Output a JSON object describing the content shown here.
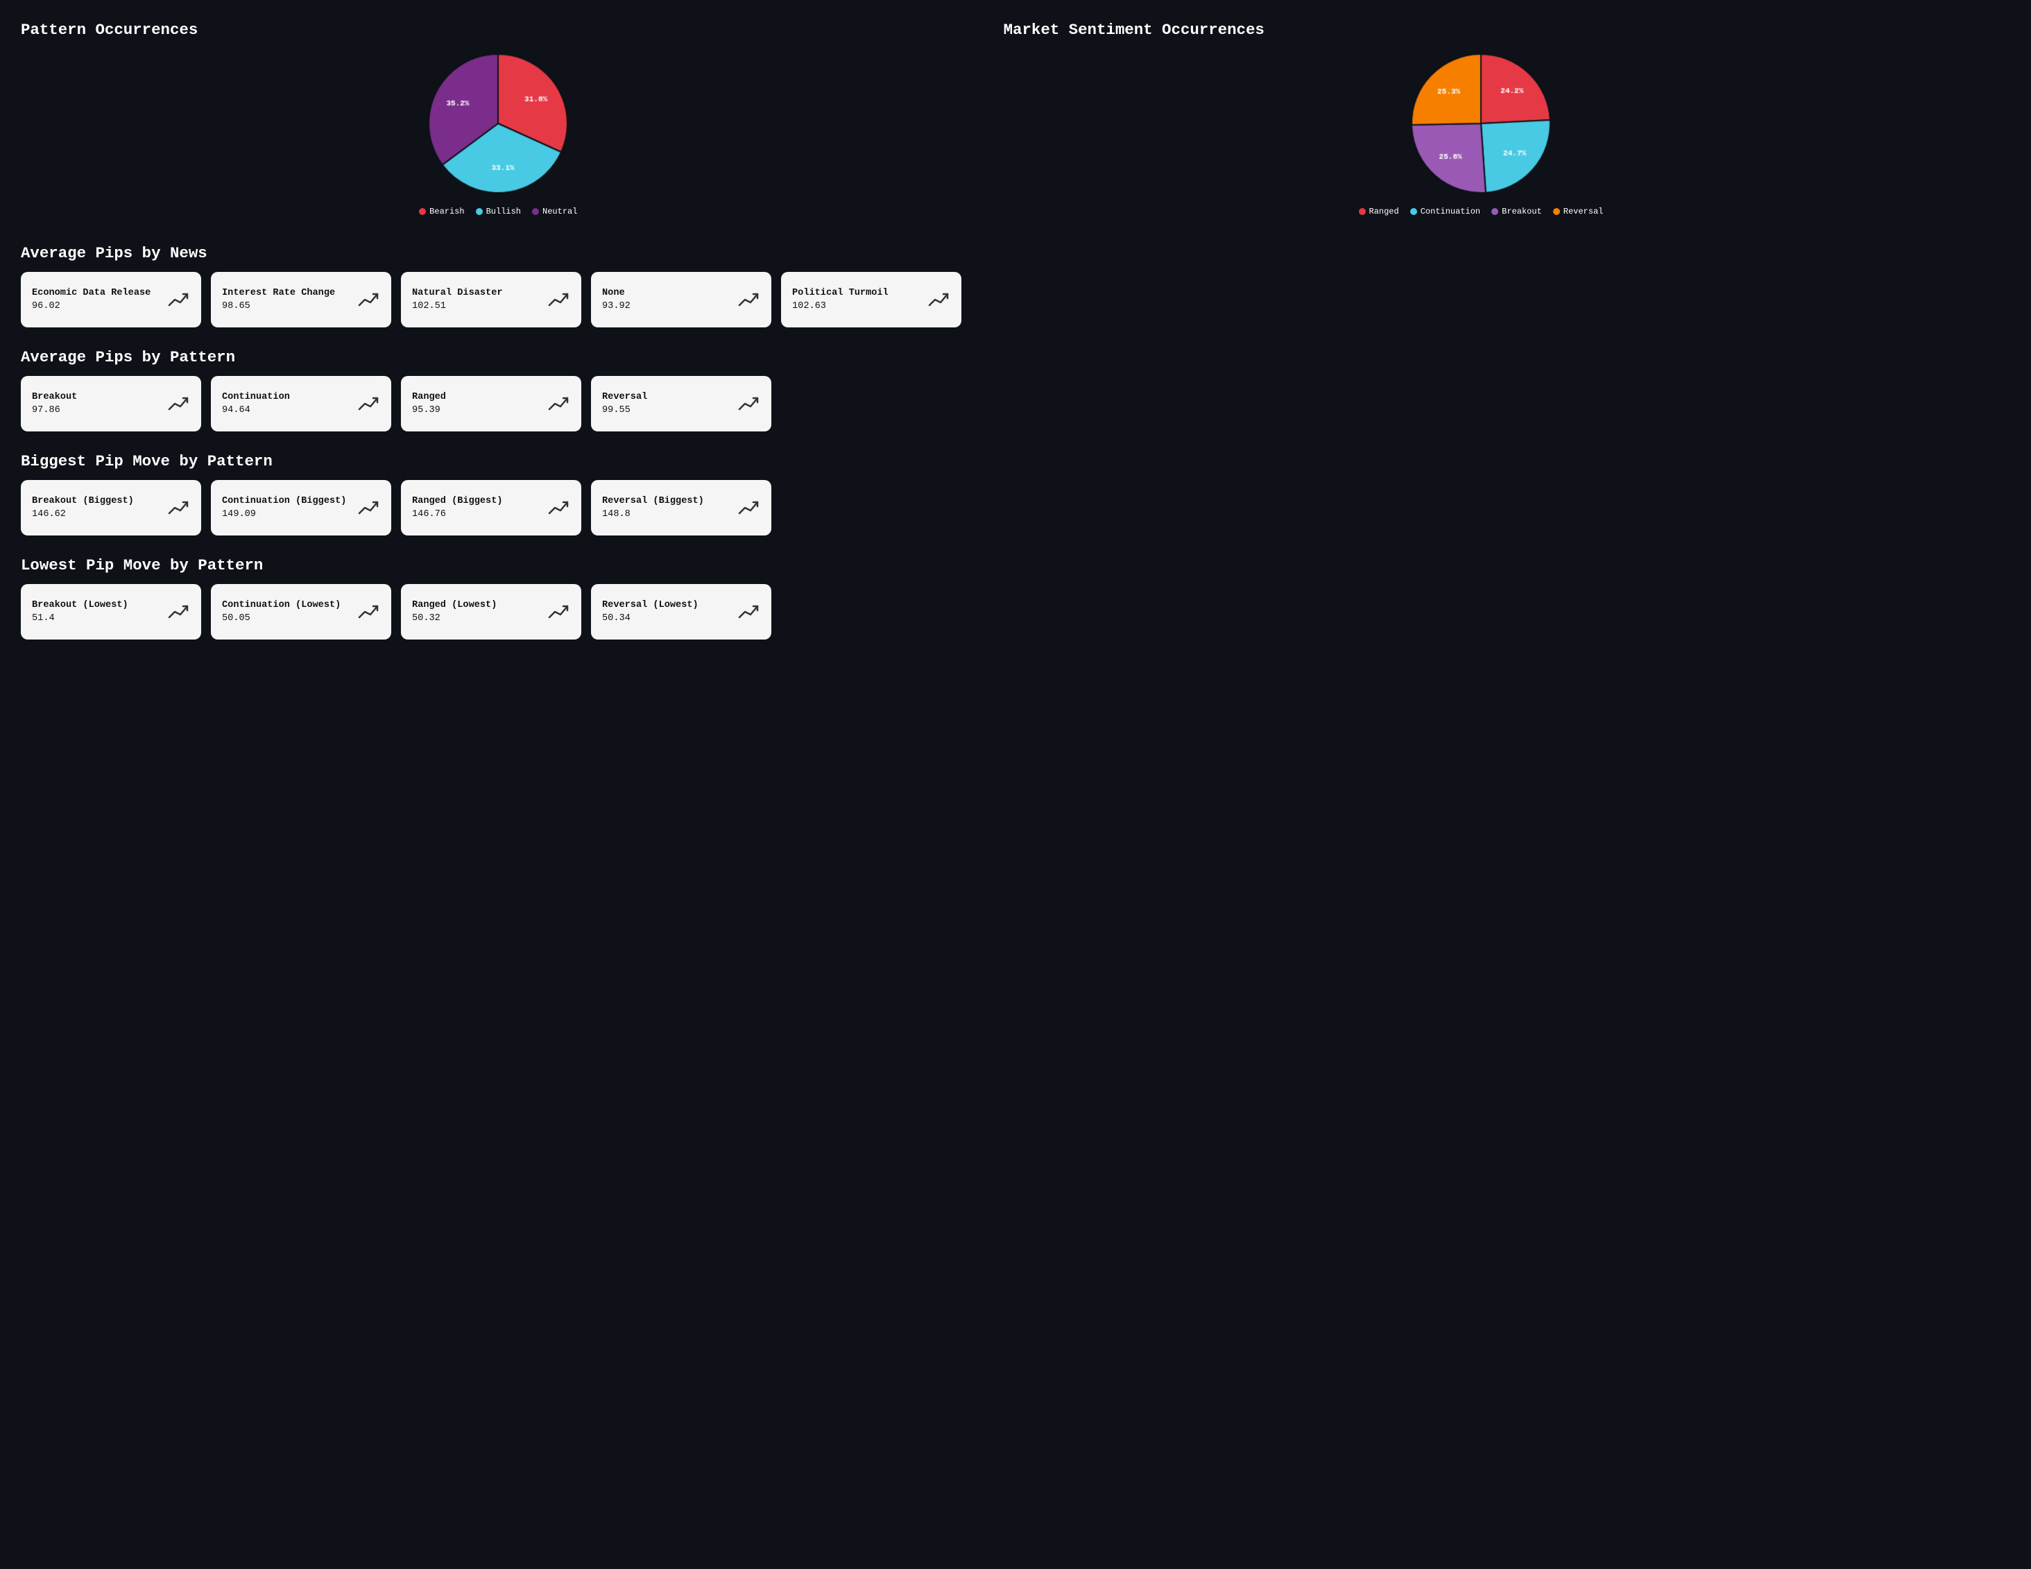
{
  "patternChart": {
    "title": "Pattern Occurrences",
    "segments": [
      {
        "label": "Bearish",
        "value": 31.8,
        "color": "#e63946"
      },
      {
        "label": "Bullish",
        "value": 33.1,
        "color": "#48cae4"
      },
      {
        "label": "Neutral",
        "value": 35.2,
        "color": "#7b2d8b"
      }
    ]
  },
  "sentimentChart": {
    "title": "Market Sentiment Occurrences",
    "segments": [
      {
        "label": "Ranged",
        "value": 24.2,
        "color": "#e63946"
      },
      {
        "label": "Continuation",
        "value": 24.7,
        "color": "#48cae4"
      },
      {
        "label": "Breakout",
        "value": 25.8,
        "color": "#9b59b6"
      },
      {
        "label": "Reversal",
        "value": 25.3,
        "color": "#f77f00"
      }
    ]
  },
  "avgPipsByNews": {
    "title": "Average Pips by News",
    "cards": [
      {
        "label": "Economic Data Release",
        "value": "96.02"
      },
      {
        "label": "Interest Rate Change",
        "value": "98.65"
      },
      {
        "label": "Natural Disaster",
        "value": "102.51"
      },
      {
        "label": "None",
        "value": "93.92"
      },
      {
        "label": "Political Turmoil",
        "value": "102.63"
      }
    ]
  },
  "avgPipsByPattern": {
    "title": "Average Pips by Pattern",
    "cards": [
      {
        "label": "Breakout",
        "value": "97.86"
      },
      {
        "label": "Continuation",
        "value": "94.64"
      },
      {
        "label": "Ranged",
        "value": "95.39"
      },
      {
        "label": "Reversal",
        "value": "99.55"
      }
    ]
  },
  "biggestPipByPattern": {
    "title": "Biggest Pip Move by Pattern",
    "cards": [
      {
        "label": "Breakout (Biggest)",
        "value": "146.62"
      },
      {
        "label": "Continuation (Biggest)",
        "value": "149.09"
      },
      {
        "label": "Ranged (Biggest)",
        "value": "146.76"
      },
      {
        "label": "Reversal (Biggest)",
        "value": "148.8"
      }
    ]
  },
  "lowestPipByPattern": {
    "title": "Lowest Pip Move by Pattern",
    "cards": [
      {
        "label": "Breakout (Lowest)",
        "value": "51.4"
      },
      {
        "label": "Continuation (Lowest)",
        "value": "50.05"
      },
      {
        "label": "Ranged (Lowest)",
        "value": "50.32"
      },
      {
        "label": "Reversal (Lowest)",
        "value": "50.34"
      }
    ]
  }
}
